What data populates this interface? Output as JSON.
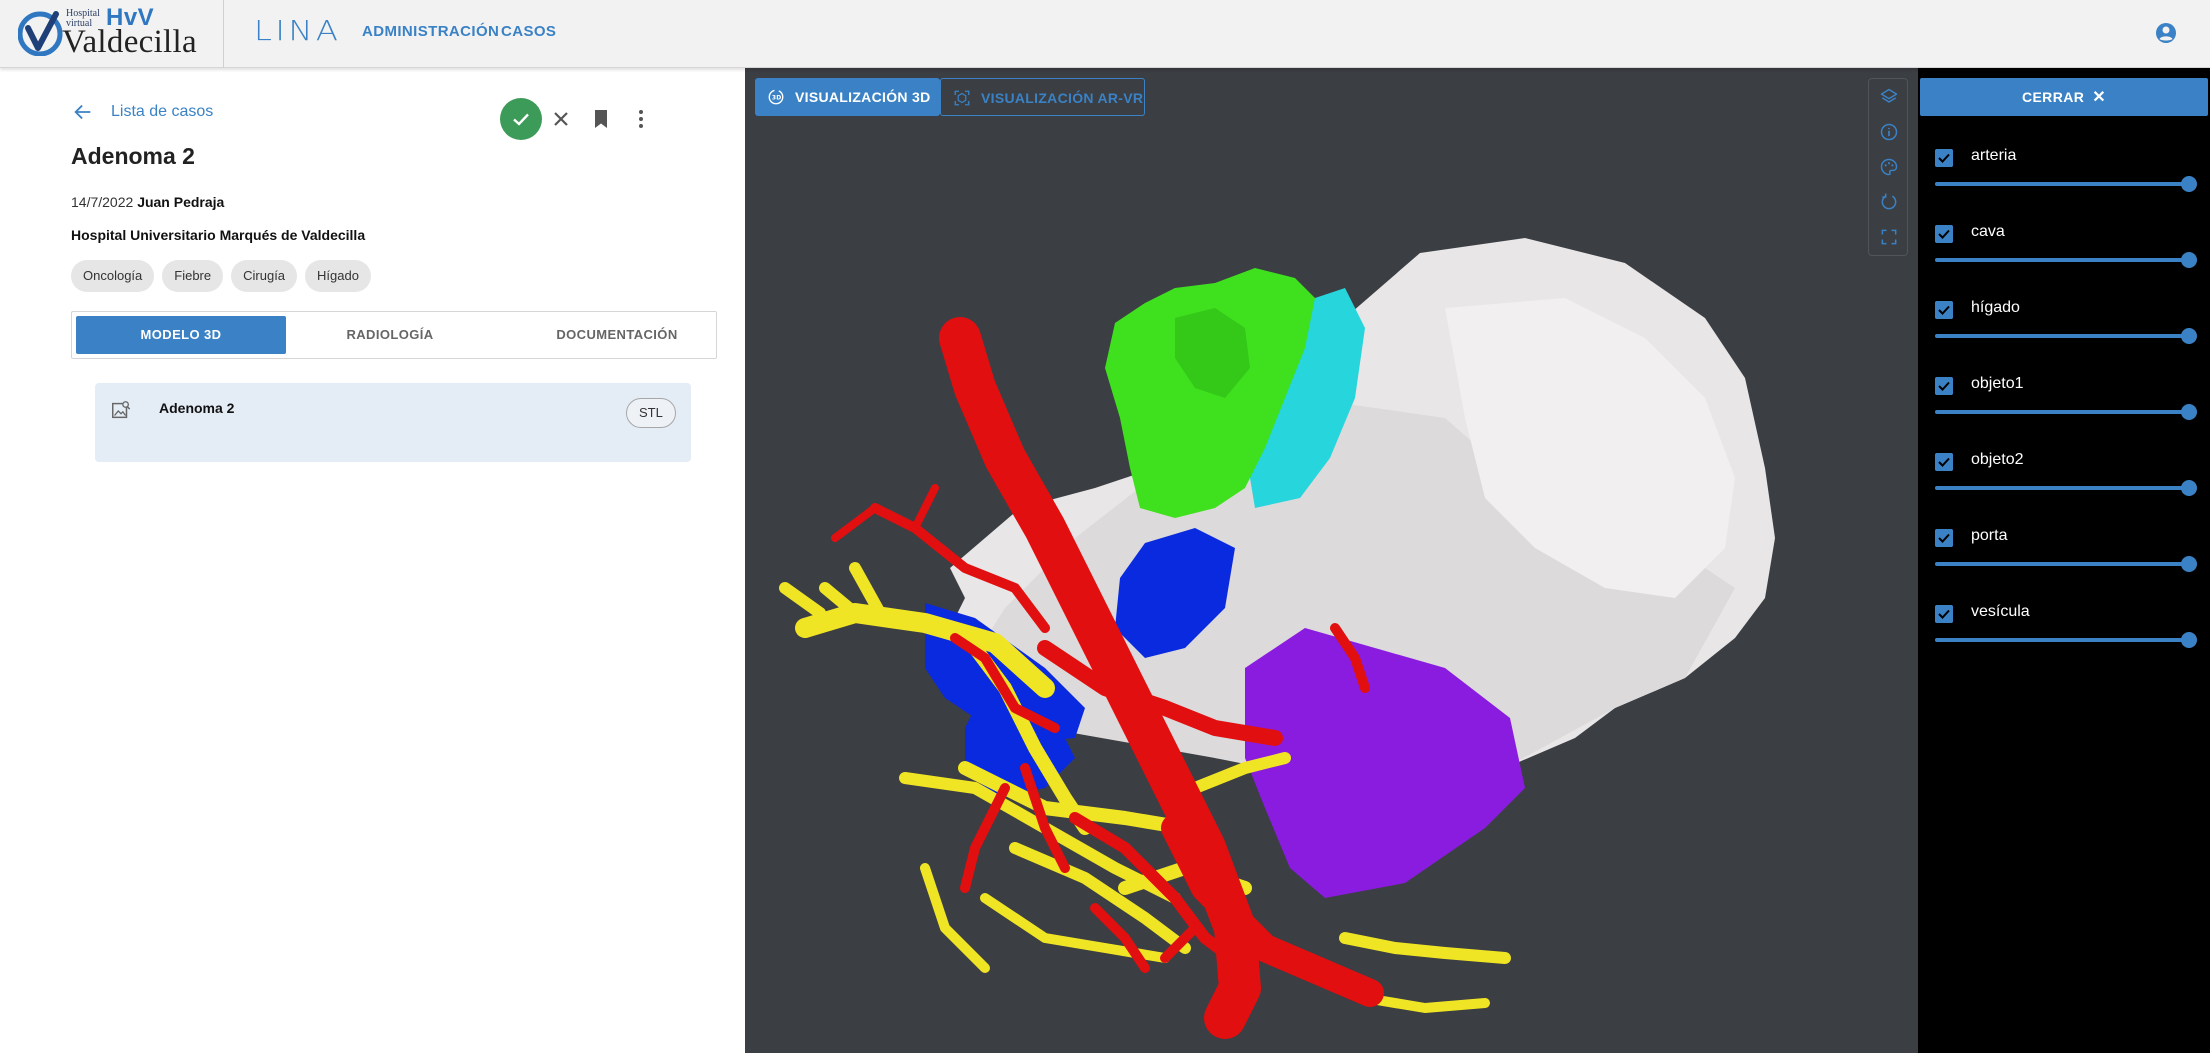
{
  "header": {
    "logo": {
      "line1": "Hospital",
      "line2": "virtual",
      "brand": "HvV",
      "name": "Valdecilla"
    },
    "app_name": "LINA",
    "nav": [
      "ADMINISTRACIÓN",
      "CASOS"
    ]
  },
  "case": {
    "back_label": "Lista de casos",
    "title": "Adenoma 2",
    "date": "14/7/2022",
    "author": "Juan Pedraja",
    "hospital": "Hospital Universitario Marqués de Valdecilla",
    "tags": [
      "Oncología",
      "Fiebre",
      "Cirugía",
      "Hígado"
    ],
    "tabs": [
      "MODELO 3D",
      "RADIOLOGÍA",
      "DOCUMENTACIÓN"
    ],
    "active_tab": "MODELO 3D",
    "file": {
      "name": "Adenoma 2",
      "format": "STL"
    }
  },
  "viewer": {
    "tabs": [
      "VISUALIZACIÓN 3D",
      "VISUALIZACIÓN AR-VR"
    ],
    "active_tab": "VISUALIZACIÓN 3D",
    "toolbar_icons": [
      "layers-icon",
      "info-icon",
      "palette-icon",
      "reset-rotation-icon",
      "fullscreen-icon"
    ]
  },
  "layers_panel": {
    "close_label": "CERRAR",
    "layers": [
      {
        "name": "arteria",
        "visible": true,
        "opacity": 1.0
      },
      {
        "name": "cava",
        "visible": true,
        "opacity": 1.0
      },
      {
        "name": "hígado",
        "visible": true,
        "opacity": 1.0
      },
      {
        "name": "objeto1",
        "visible": true,
        "opacity": 1.0
      },
      {
        "name": "objeto2",
        "visible": true,
        "opacity": 1.0
      },
      {
        "name": "porta",
        "visible": true,
        "opacity": 1.0
      },
      {
        "name": "vesícula",
        "visible": true,
        "opacity": 1.0
      }
    ]
  },
  "colors": {
    "accent": "#3a82c5",
    "success": "#3d9b5a",
    "viewer_bg": "#3b3e43",
    "arteria": "#e10f0f",
    "cava": "#0a2ae0",
    "higado": "#e8e6e6",
    "objeto1": "#3fe01d",
    "objeto2": "#27d5dc",
    "porta": "#f0e524",
    "vesicula": "#8a1ce0"
  }
}
